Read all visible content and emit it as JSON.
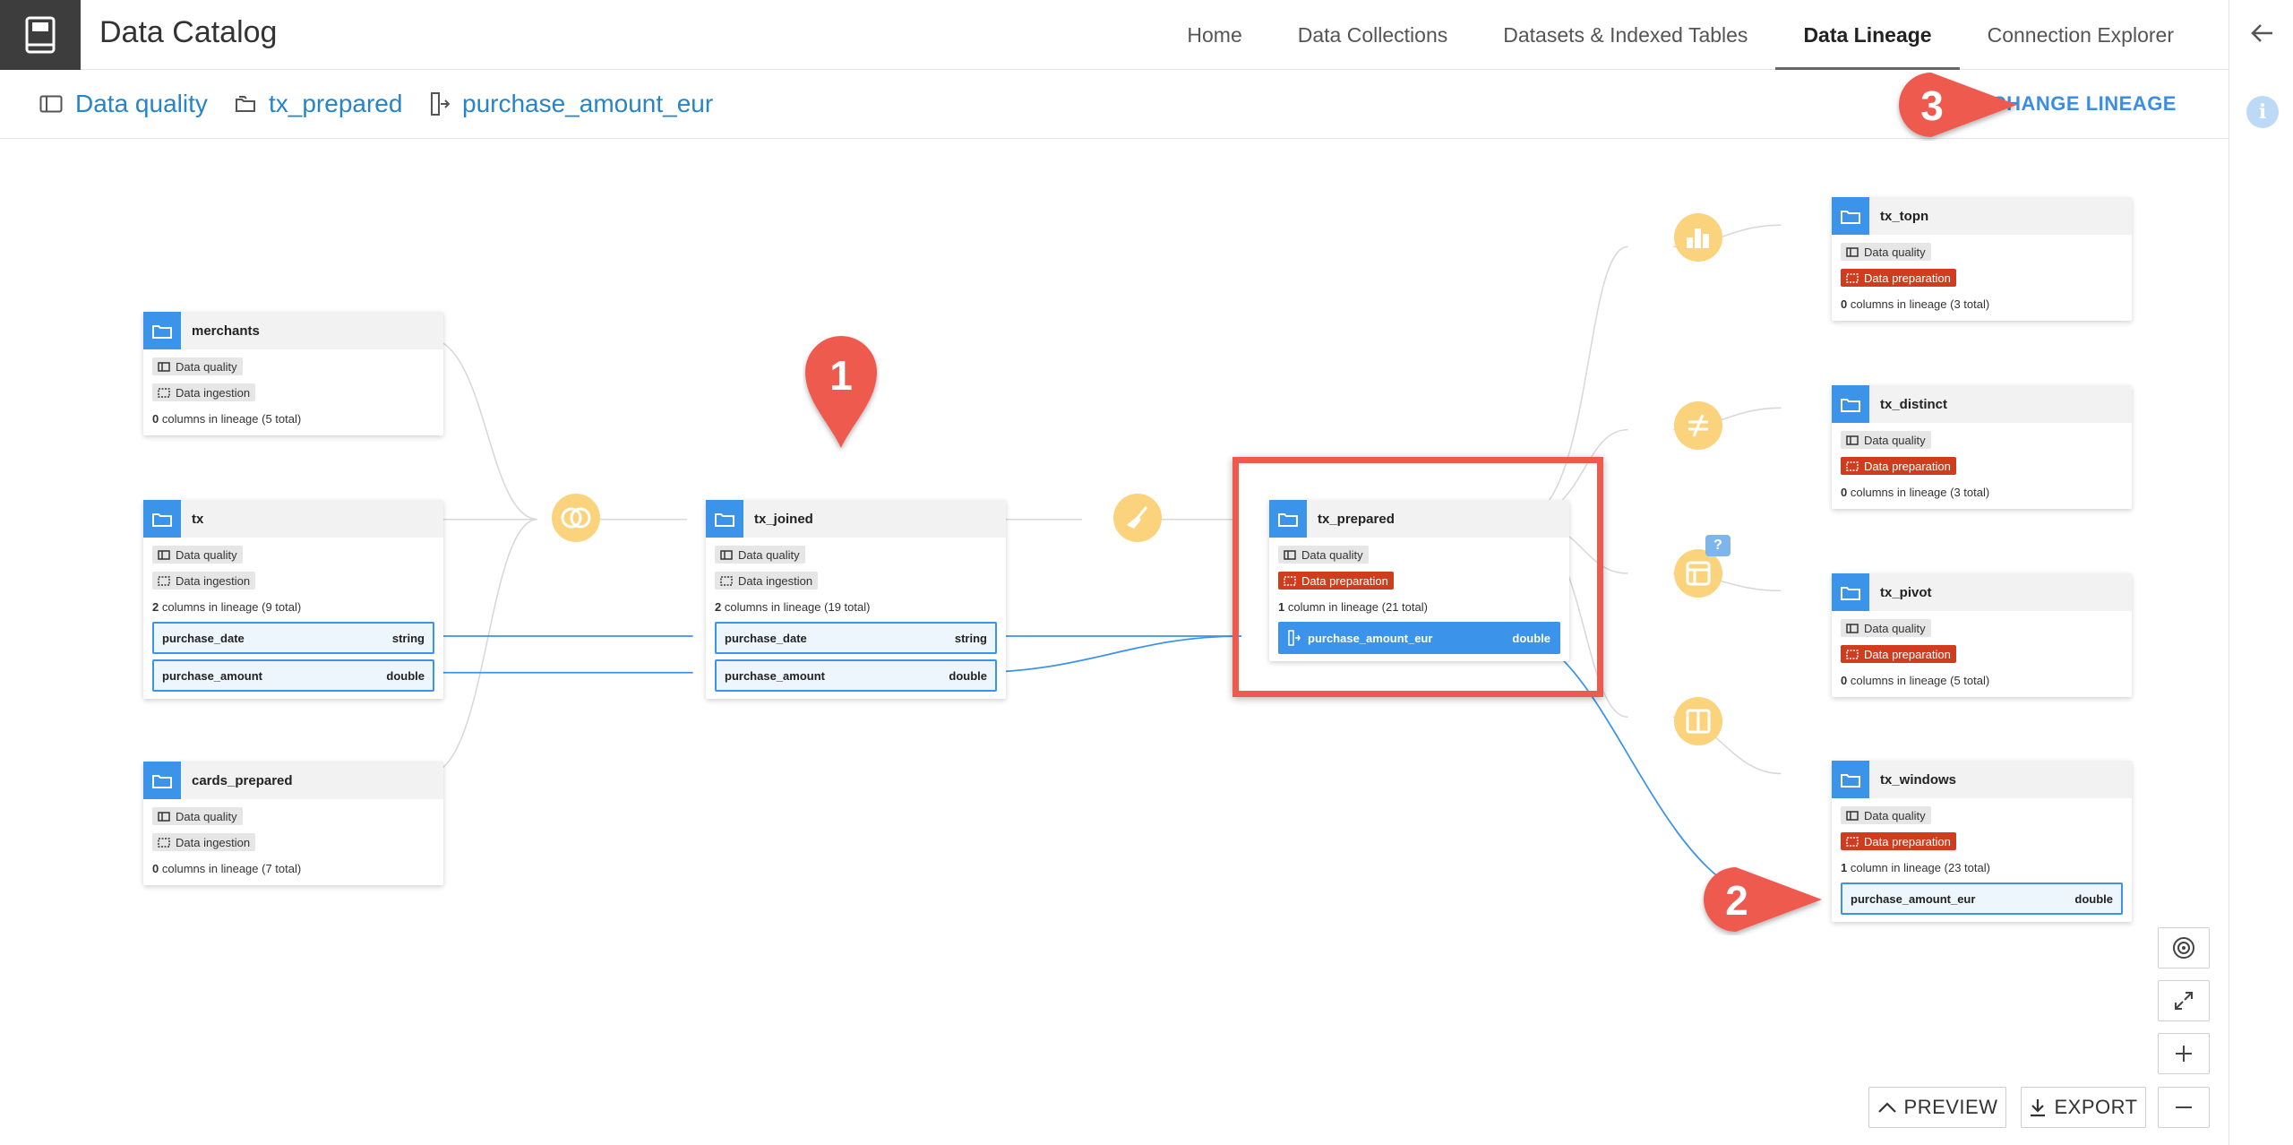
{
  "header": {
    "app_title": "Data Catalog",
    "tabs": [
      {
        "label": "Home"
      },
      {
        "label": "Data Collections"
      },
      {
        "label": "Datasets & Indexed Tables"
      },
      {
        "label": "Data Lineage",
        "active": true
      },
      {
        "label": "Connection Explorer"
      }
    ]
  },
  "breadcrumb": {
    "project": "Data quality",
    "dataset": "tx_prepared",
    "column": "purchase_amount_eur"
  },
  "actions": {
    "change_lineage": "CHANGE LINEAGE",
    "preview": "PREVIEW",
    "export": "EXPORT"
  },
  "markers": [
    "1",
    "2",
    "3"
  ],
  "recipe_badge": "?",
  "nodes": {
    "merchants": {
      "name": "merchants",
      "tags": [
        "Data quality",
        "Data ingestion"
      ],
      "count": "0",
      "count_suffix": " columns in lineage (5 total)"
    },
    "tx": {
      "name": "tx",
      "tags": [
        "Data quality",
        "Data ingestion"
      ],
      "count": "2",
      "count_suffix": " columns in lineage (9 total)",
      "columns": [
        {
          "name": "purchase_date",
          "type": "string"
        },
        {
          "name": "purchase_amount",
          "type": "double"
        }
      ]
    },
    "cards_prepared": {
      "name": "cards_prepared",
      "tags": [
        "Data quality",
        "Data ingestion"
      ],
      "count": "0",
      "count_suffix": " columns in lineage (7 total)"
    },
    "tx_joined": {
      "name": "tx_joined",
      "tags": [
        "Data quality",
        "Data ingestion"
      ],
      "count": "2",
      "count_suffix": " columns in lineage (19 total)",
      "columns": [
        {
          "name": "purchase_date",
          "type": "string"
        },
        {
          "name": "purchase_amount",
          "type": "double"
        }
      ]
    },
    "tx_prepared": {
      "name": "tx_prepared",
      "tags": [
        "Data quality",
        "Data preparation"
      ],
      "count": "1",
      "count_suffix": " column in lineage (21 total)",
      "columns": [
        {
          "name": "purchase_amount_eur",
          "type": "double"
        }
      ]
    },
    "tx_topn": {
      "name": "tx_topn",
      "tags": [
        "Data quality",
        "Data preparation"
      ],
      "count": "0",
      "count_suffix": " columns in lineage (3 total)"
    },
    "tx_distinct": {
      "name": "tx_distinct",
      "tags": [
        "Data quality",
        "Data preparation"
      ],
      "count": "0",
      "count_suffix": " columns in lineage (3 total)"
    },
    "tx_pivot": {
      "name": "tx_pivot",
      "tags": [
        "Data quality",
        "Data preparation"
      ],
      "count": "0",
      "count_suffix": " columns in lineage (5 total)"
    },
    "tx_windows": {
      "name": "tx_windows",
      "tags": [
        "Data quality",
        "Data preparation"
      ],
      "count": "1",
      "count_suffix": " column in lineage (23 total)",
      "columns": [
        {
          "name": "purchase_amount_eur",
          "type": "double"
        }
      ]
    }
  },
  "colors": {
    "accent": "#3c93ea",
    "link": "#2684c9",
    "recipe": "#fbd37d",
    "prep_tag": "#d13c1f",
    "marker": "#ef5a4f"
  }
}
